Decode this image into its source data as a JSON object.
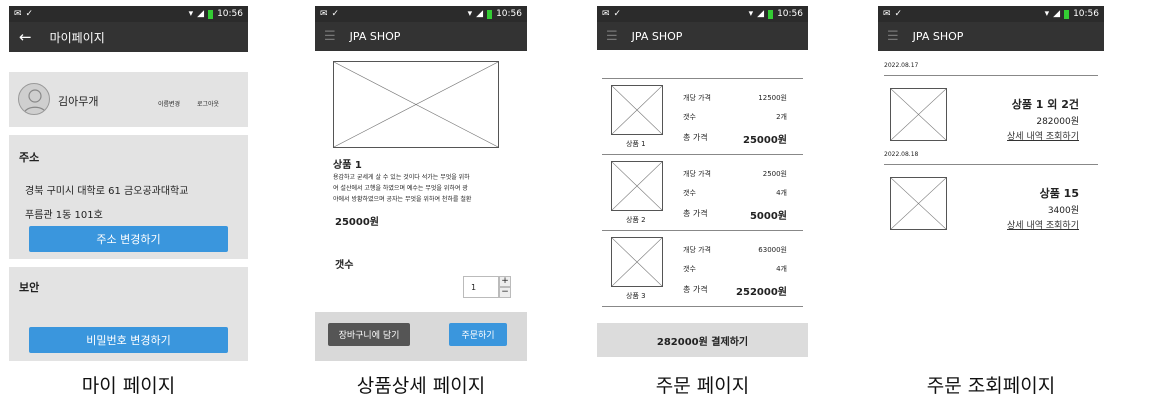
{
  "status": {
    "time": "10:56"
  },
  "captions": [
    "마이 페이지",
    "상품상세 페이지",
    "주문 페이지",
    "주문 조회페이지"
  ],
  "mypage": {
    "title": "마이페이지",
    "user_name": "김아무개",
    "change_name": "이름변경",
    "logout": "로그아웃",
    "address_heading": "주소",
    "address_line1": "경북 구미시 대학로 61 금오공과대학교",
    "address_line2": "푸름관 1동 101호",
    "change_address": "주소 변경하기",
    "security_heading": "보안",
    "change_password": "비밀번호 변경하기"
  },
  "detail": {
    "title": "JPA SHOP",
    "product_name": "상품 1",
    "description": [
      "용감하고 굳세게 살 수 있는 것이다 석가는 무엇을 위하",
      "여 설산에서 고행을 하였으며 예수는 무엇을 위하여 광",
      "야에서 방황하였으며 공자는 무엇을 위하여 천하를 철환"
    ],
    "price": "25000원",
    "qty_label": "갯수",
    "qty_value": "1",
    "cart_button": "장바구니에 담기",
    "order_button": "주문하기"
  },
  "order": {
    "title": "JPA SHOP",
    "unit_price_label": "개당 가격",
    "qty_label": "갯수",
    "total_label": "총 가격",
    "items": [
      {
        "name": "상품 1",
        "unit_price": "12500원",
        "qty": "2개",
        "total": "25000원"
      },
      {
        "name": "상품 2",
        "unit_price": "2500원",
        "qty": "4개",
        "total": "5000원"
      },
      {
        "name": "상품 3",
        "unit_price": "63000원",
        "qty": "4개",
        "total": "252000원"
      }
    ],
    "pay_button": "282000원 결제하기"
  },
  "history": {
    "title": "JPA SHOP",
    "detail_link": "상세 내역 조회하기",
    "orders": [
      {
        "date": "2022.08.17",
        "name": "상품 1 외 2건",
        "price": "282000원"
      },
      {
        "date": "2022.08.18",
        "name": "상품 15",
        "price": "3400원"
      }
    ]
  }
}
